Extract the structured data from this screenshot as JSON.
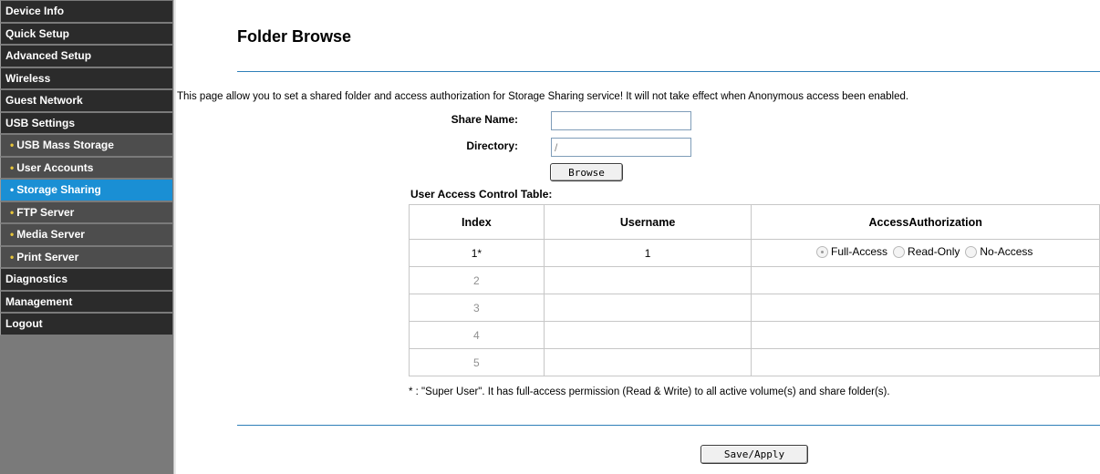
{
  "sidebar": {
    "items": [
      {
        "label": "Device Info"
      },
      {
        "label": "Quick Setup"
      },
      {
        "label": "Advanced Setup"
      },
      {
        "label": "Wireless"
      },
      {
        "label": "Guest Network"
      },
      {
        "label": "USB Settings"
      },
      {
        "label": "USB Mass Storage"
      },
      {
        "label": "User Accounts"
      },
      {
        "label": "Storage Sharing"
      },
      {
        "label": "FTP Server"
      },
      {
        "label": "Media Server"
      },
      {
        "label": "Print Server"
      },
      {
        "label": "Diagnostics"
      },
      {
        "label": "Management"
      },
      {
        "label": "Logout"
      }
    ],
    "bullet": "•",
    "active": "Storage Sharing"
  },
  "page": {
    "title": "Folder Browse",
    "description": "This page allow you to set a shared folder and access authorization for Storage Sharing service! It will not take effect when Anonymous access been enabled."
  },
  "form": {
    "share_name_label": "Share Name:",
    "share_name_value": "",
    "directory_label": "Directory:",
    "directory_value": "/",
    "browse_label": "Browse"
  },
  "table": {
    "caption": "User Access Control Table:",
    "headers": [
      "Index",
      "Username",
      "AccessAuthorization"
    ],
    "rows": [
      {
        "index": "1*",
        "username": "1"
      },
      {
        "index": "2",
        "username": ""
      },
      {
        "index": "3",
        "username": ""
      },
      {
        "index": "4",
        "username": ""
      },
      {
        "index": "5",
        "username": ""
      }
    ],
    "access_options": [
      "Full-Access",
      "Read-Only",
      "No-Access"
    ],
    "selected_access": "Full-Access"
  },
  "footnote": "* : \"Super User\". It has full-access permission (Read & Write) to all active volume(s) and share folder(s).",
  "save_label": "Save/Apply",
  "colors": {
    "sidebar_bg": "#2b2b2b",
    "sidebar_active": "#1a8fd4",
    "divider_line": "#2e7fb8"
  }
}
